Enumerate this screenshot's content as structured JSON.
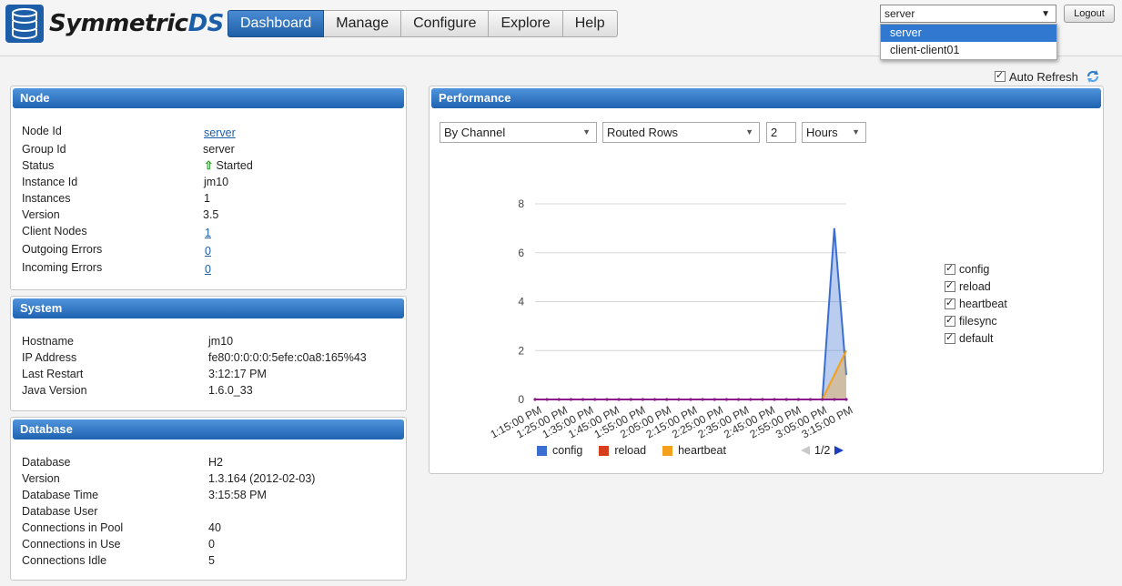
{
  "app": {
    "name_prefix": "Symmetric",
    "name_suffix": "DS"
  },
  "nav": [
    {
      "label": "Dashboard",
      "active": true
    },
    {
      "label": "Manage"
    },
    {
      "label": "Configure"
    },
    {
      "label": "Explore"
    },
    {
      "label": "Help"
    }
  ],
  "node_selector": {
    "value": "server",
    "options": [
      "server",
      "client-client01"
    ]
  },
  "logout_label": "Logout",
  "auto_refresh": {
    "label": "Auto Refresh",
    "checked": true
  },
  "node_panel": {
    "title": "Node",
    "rows": [
      {
        "key": "Node Id",
        "value": "server"
      },
      {
        "key": "Group Id",
        "value": "server"
      },
      {
        "key": "Status",
        "value": "Started"
      },
      {
        "key": "Instance Id",
        "value": "jm10"
      },
      {
        "key": "Instances",
        "value": "1"
      },
      {
        "key": "Version",
        "value": "3.5"
      },
      {
        "key": "Client Nodes",
        "value": "1"
      },
      {
        "key": "Outgoing Errors",
        "value": "0"
      },
      {
        "key": "Incoming Errors",
        "value": "0"
      }
    ]
  },
  "system_panel": {
    "title": "System",
    "rows": [
      {
        "key": "Hostname",
        "value": "jm10"
      },
      {
        "key": "IP Address",
        "value": "fe80:0:0:0:0:5efe:c0a8:165%43"
      },
      {
        "key": "Last Restart",
        "value": "3:12:17 PM"
      },
      {
        "key": "Java Version",
        "value": "1.6.0_33"
      }
    ]
  },
  "database_panel": {
    "title": "Database",
    "rows": [
      {
        "key": "Database",
        "value": "H2"
      },
      {
        "key": "Version",
        "value": "1.3.164 (2012-02-03)"
      },
      {
        "key": "Database Time",
        "value": "3:15:58 PM"
      },
      {
        "key": "Database User",
        "value": ""
      },
      {
        "key": "Connections in Pool",
        "value": "40"
      },
      {
        "key": "Connections in Use",
        "value": "0"
      },
      {
        "key": "Connections Idle",
        "value": "5"
      }
    ]
  },
  "performance": {
    "title": "Performance",
    "group_by": "By Channel",
    "metric": "Routed Rows",
    "period_value": "2",
    "period_unit": "Hours",
    "legend_checkboxes": [
      "config",
      "reload",
      "heartbeat",
      "filesync",
      "default"
    ],
    "bottom_legend": [
      {
        "name": "config",
        "color": "#3a6fd1"
      },
      {
        "name": "reload",
        "color": "#d63e1e"
      },
      {
        "name": "heartbeat",
        "color": "#f5a01d"
      }
    ],
    "pager": "1/2"
  },
  "chart_data": {
    "type": "area",
    "x": [
      "1:15:00 PM",
      "1:25:00 PM",
      "1:35:00 PM",
      "1:45:00 PM",
      "1:55:00 PM",
      "2:05:00 PM",
      "2:15:00 PM",
      "2:25:00 PM",
      "2:35:00 PM",
      "2:45:00 PM",
      "2:55:00 PM",
      "3:05:00 PM",
      "3:15:00 PM"
    ],
    "x_tick_labels": [
      "1:15:00 PM",
      "1:25:00 PM",
      "1:35:00 PM",
      "1:45:00 PM",
      "1:55:00 PM",
      "2:05:00 PM",
      "2:15:00 PM",
      "2:25:00 PM",
      "2:35:00 PM",
      "2:45:00 PM",
      "2:55:00 PM",
      "3:05:00 PM",
      "3:15:00 PM"
    ],
    "y_ticks": [
      0,
      2,
      4,
      6,
      8
    ],
    "ylim": [
      0,
      8
    ],
    "grid": true,
    "series": [
      {
        "name": "config",
        "color": "#3a6fd1",
        "values": [
          0,
          0,
          0,
          0,
          0,
          0,
          0,
          0,
          0,
          0,
          0,
          0,
          0,
          0,
          0,
          0,
          0,
          0,
          0,
          0,
          0,
          0,
          0,
          0,
          0,
          7,
          1
        ]
      },
      {
        "name": "reload",
        "color": "#d63e1e",
        "values": [
          0,
          0,
          0,
          0,
          0,
          0,
          0,
          0,
          0,
          0,
          0,
          0,
          0,
          0,
          0,
          0,
          0,
          0,
          0,
          0,
          0,
          0,
          0,
          0,
          0,
          0,
          0
        ]
      },
      {
        "name": "heartbeat",
        "color": "#f5a01d",
        "values": [
          0,
          0,
          0,
          0,
          0,
          0,
          0,
          0,
          0,
          0,
          0,
          0,
          0,
          0,
          0,
          0,
          0,
          0,
          0,
          0,
          0,
          0,
          0,
          0,
          0,
          1,
          2
        ]
      }
    ]
  }
}
